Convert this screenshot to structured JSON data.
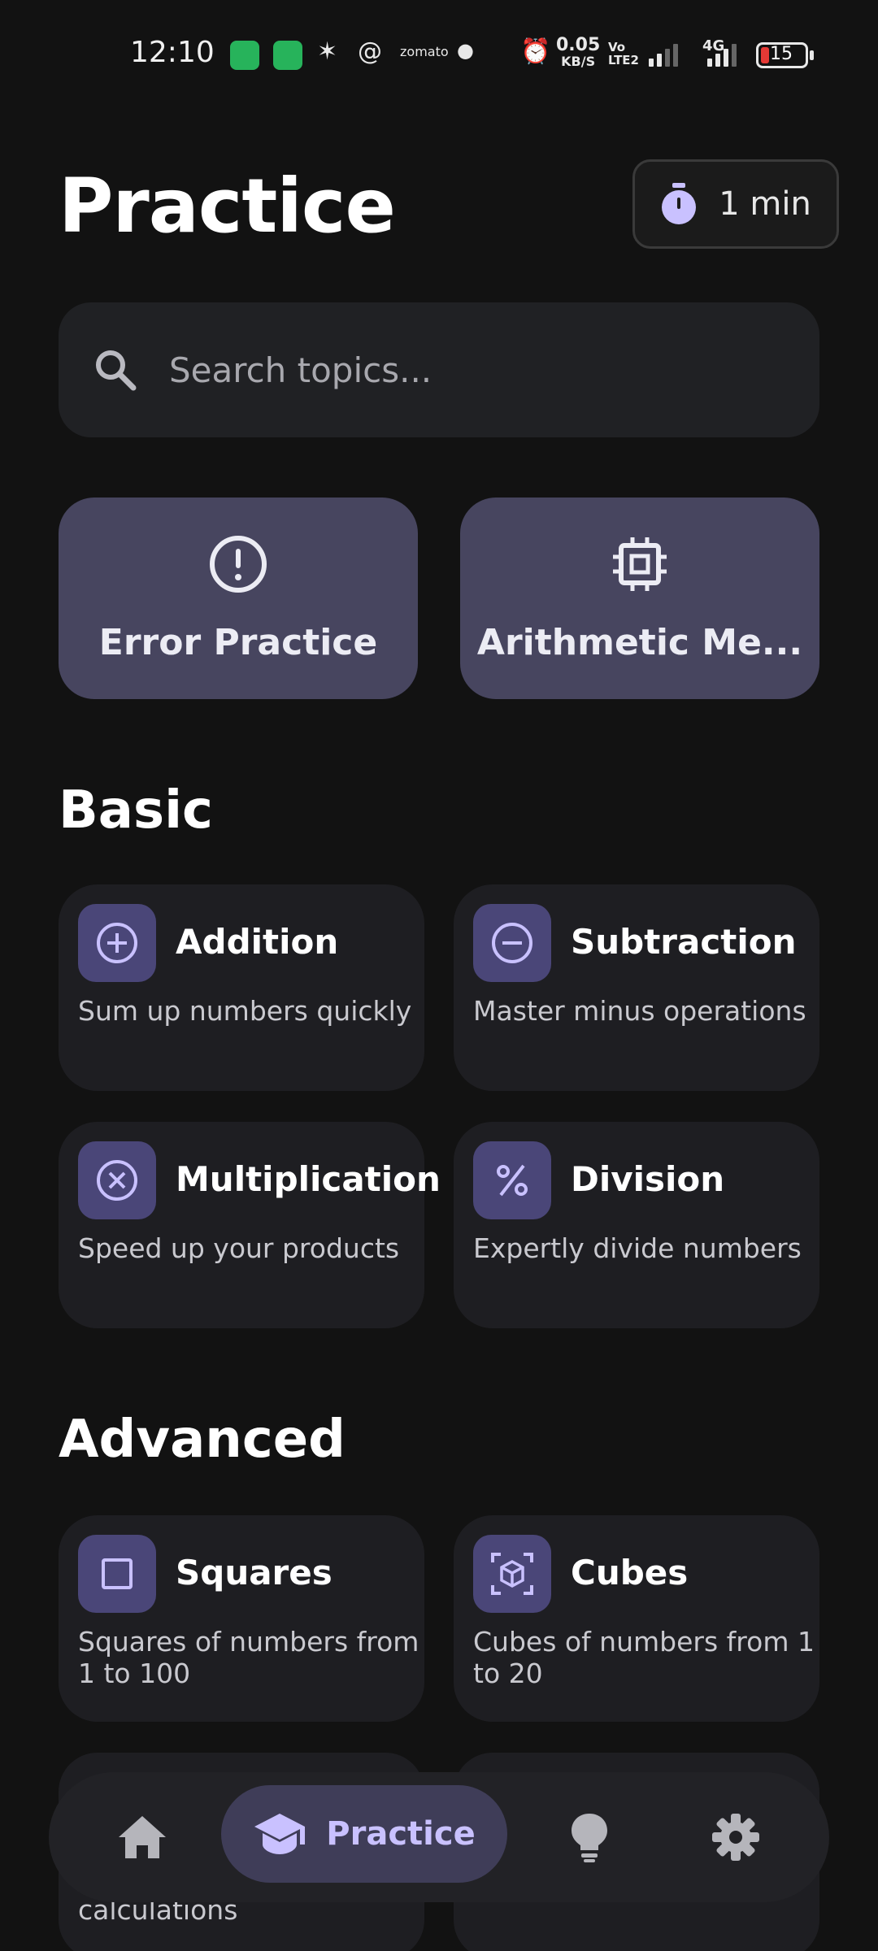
{
  "status_bar": {
    "time": "12:10",
    "speed_value": "0.05",
    "speed_unit": "KB/S",
    "volte": "Vo LTE2",
    "network": "4G",
    "battery": "15",
    "icons": [
      "battery-saver-icon",
      "shield-app-icon",
      "sparkle-icon",
      "threads-icon",
      "zomato-icon",
      "dot-icon",
      "alarm-icon",
      "signal-icon",
      "battery-icon"
    ],
    "zomato": "zomato"
  },
  "header": {
    "title": "Practice",
    "timer_label": "1 min"
  },
  "search": {
    "placeholder": "Search topics..."
  },
  "quick_actions": [
    {
      "label": "Error Practice",
      "icon": "alert-circle-icon"
    },
    {
      "label": "Arithmetic Me...",
      "icon": "chip-icon"
    }
  ],
  "sections": {
    "basic": {
      "title": "Basic",
      "cards": [
        {
          "title": "Addition",
          "description": "Sum up numbers quickly",
          "icon": "plus-circle-icon"
        },
        {
          "title": "Subtraction",
          "description": "Master minus operations",
          "icon": "minus-circle-icon"
        },
        {
          "title": "Multiplication",
          "description": "Speed up your products",
          "icon": "times-circle-icon"
        },
        {
          "title": "Division",
          "description": "Expertly divide numbers",
          "icon": "percent-icon"
        }
      ]
    },
    "advanced": {
      "title": "Advanced",
      "cards": [
        {
          "title": "Squares",
          "description": "Squares of numbers from 1 to 100",
          "icon": "square-icon"
        },
        {
          "title": "Cubes",
          "description": "Cubes of numbers from 1 to 20",
          "icon": "cube-icon"
        },
        {
          "title": "",
          "description": "calculations",
          "icon": ""
        },
        {
          "title": "",
          "description": "",
          "icon": ""
        }
      ]
    }
  },
  "bottom_nav": {
    "items": [
      {
        "label": "",
        "icon": "home-icon"
      },
      {
        "label": "Practice",
        "icon": "graduation-cap-icon",
        "active": true
      },
      {
        "label": "",
        "icon": "lightbulb-icon"
      },
      {
        "label": "",
        "icon": "settings-gear-icon"
      }
    ]
  },
  "colors": {
    "background": "#121212",
    "card": "#1e1e22",
    "quick_tile": "#47455f",
    "icon_tile": "#4a4678",
    "accent": "#c9c1ff"
  }
}
